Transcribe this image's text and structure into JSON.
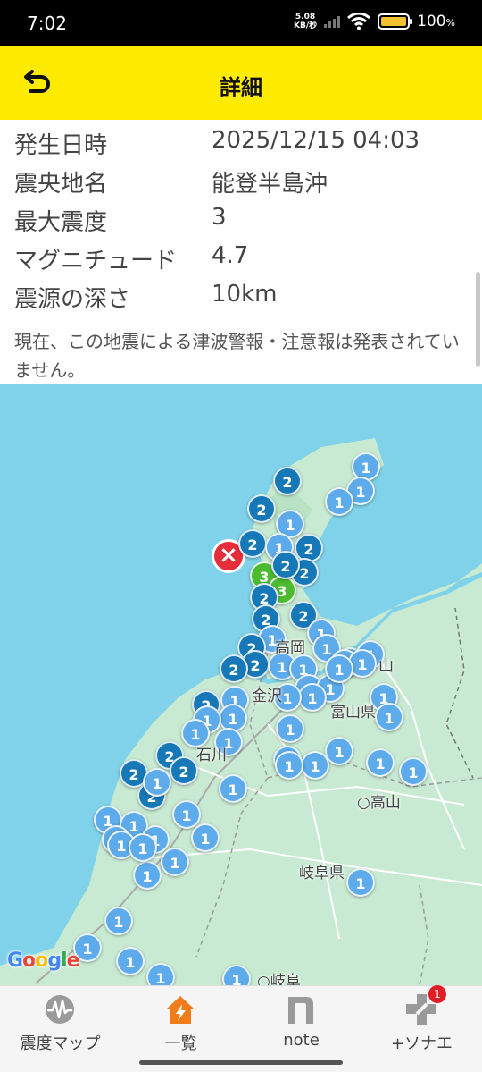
{
  "status_bar": {
    "time": "7:02",
    "net_speed_value": "5.08",
    "net_speed_unit": "KB/秒",
    "battery": "100",
    "battery_unit": "%"
  },
  "header": {
    "title": "詳細"
  },
  "details": {
    "rows": [
      {
        "label": "発生日時",
        "value": "2025/12/15 04:03"
      },
      {
        "label": "震央地名",
        "value": "能登半島沖"
      },
      {
        "label": "最大震度",
        "value": "3"
      },
      {
        "label": "マグニチュード",
        "value": "4.7"
      },
      {
        "label": "震源の深さ",
        "value": "10km"
      }
    ],
    "tsunami_note": "現在、この地震による津波警報・注意報は発表されていません。"
  },
  "map": {
    "labels": {
      "kanazawa": "金沢",
      "ishikawa": "石川",
      "toyama_pref": "富山県",
      "takayama": "高山",
      "gifu_pref": "岐阜県",
      "gifu_city": "岐阜",
      "takaoka": "高岡",
      "imizu": "山"
    },
    "attribution": "Google",
    "max_intensity": "3",
    "colors": {
      "intensity_1": "#5dabea",
      "intensity_2": "#1778b8",
      "intensity_3": "#4cbb30",
      "epicenter": "#e62e3a",
      "sea": "#7fd2e9",
      "land": "#c8ead2"
    },
    "markers": [
      {
        "intensity": "1"
      },
      {
        "intensity": "1"
      },
      {
        "intensity": "1"
      },
      {
        "intensity": "2"
      },
      {
        "intensity": "2"
      },
      {
        "intensity": "1"
      },
      {
        "intensity": "2"
      },
      {
        "intensity": "1"
      },
      {
        "intensity": "2"
      },
      {
        "intensity": "3"
      },
      {
        "intensity": "2"
      },
      {
        "intensity": "3"
      },
      {
        "intensity": "2"
      },
      {
        "intensity": "2"
      },
      {
        "intensity": "2"
      },
      {
        "intensity": "2"
      },
      {
        "intensity": "1"
      },
      {
        "intensity": "1"
      },
      {
        "intensity": "1"
      },
      {
        "intensity": "1"
      },
      {
        "intensity": "1"
      },
      {
        "intensity": "2"
      },
      {
        "intensity": "2"
      },
      {
        "intensity": "2"
      },
      {
        "intensity": "1"
      },
      {
        "intensity": "1"
      },
      {
        "intensity": "1"
      },
      {
        "intensity": "1"
      },
      {
        "intensity": "1"
      },
      {
        "intensity": "1"
      },
      {
        "intensity": "1"
      },
      {
        "intensity": "1"
      },
      {
        "intensity": "1"
      },
      {
        "intensity": "2"
      },
      {
        "intensity": "1"
      },
      {
        "intensity": "1"
      },
      {
        "intensity": "1"
      },
      {
        "intensity": "1"
      },
      {
        "intensity": "1"
      },
      {
        "intensity": "1"
      },
      {
        "intensity": "1"
      },
      {
        "intensity": "2"
      },
      {
        "intensity": "2"
      },
      {
        "intensity": "2"
      },
      {
        "intensity": "2"
      },
      {
        "intensity": "1"
      },
      {
        "intensity": "1"
      },
      {
        "intensity": "1"
      },
      {
        "intensity": "1"
      },
      {
        "intensity": "1"
      },
      {
        "intensity": "1"
      },
      {
        "intensity": "1"
      },
      {
        "intensity": "1"
      },
      {
        "intensity": "1"
      },
      {
        "intensity": "1"
      },
      {
        "intensity": "1"
      },
      {
        "intensity": "1"
      },
      {
        "intensity": "1"
      },
      {
        "intensity": "1"
      },
      {
        "intensity": "1"
      },
      {
        "intensity": "1"
      },
      {
        "intensity": "1"
      },
      {
        "intensity": "1"
      },
      {
        "intensity": "1"
      },
      {
        "intensity": "1"
      },
      {
        "intensity": "1"
      },
      {
        "intensity": "1"
      },
      {
        "intensity": "1"
      },
      {
        "intensity": "1"
      },
      {
        "intensity": "1"
      }
    ]
  },
  "bottom_nav": {
    "items": [
      {
        "label": "震度マップ",
        "icon": "seismograph-icon"
      },
      {
        "label": "一覧",
        "icon": "house-alert-icon"
      },
      {
        "label": "note",
        "icon": "note-icon"
      },
      {
        "label": "+ソナエ",
        "icon": "plus-sonae-icon"
      }
    ],
    "badge_count": "1"
  }
}
